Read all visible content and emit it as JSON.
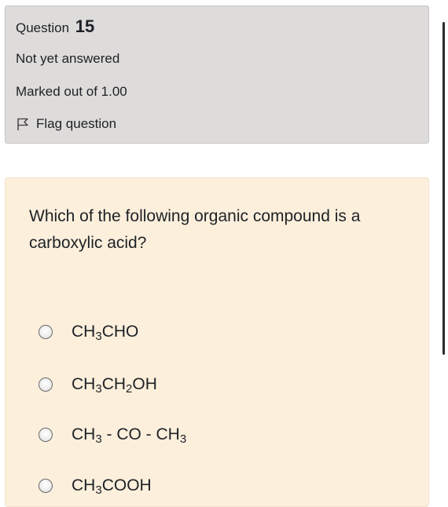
{
  "info": {
    "question_label": "Question",
    "question_number": "15",
    "state": "Not yet answered",
    "grade": "Marked out of 1.00",
    "flag_label": "Flag question"
  },
  "question": {
    "text": "Which of the following organic compound is a carboxylic acid?",
    "options": [
      {
        "parts": [
          "CH",
          "3",
          "CHO"
        ],
        "label": "CH3CHO"
      },
      {
        "parts": [
          "CH",
          "3",
          "CH",
          "2",
          "OH"
        ],
        "label": "CH3CH2OH"
      },
      {
        "parts": [
          "CH",
          "3",
          " - CO - CH",
          "3"
        ],
        "label": "CH3 - CO - CH3"
      },
      {
        "parts": [
          "CH",
          "3",
          "COOH"
        ],
        "label": "CH3COOH"
      }
    ]
  },
  "colors": {
    "info_background": "#dedbdb",
    "question_background": "#fcefdc",
    "text": "#1d2125"
  },
  "icons": {
    "flag": "flag-icon",
    "radio": "radio-button-icon"
  }
}
